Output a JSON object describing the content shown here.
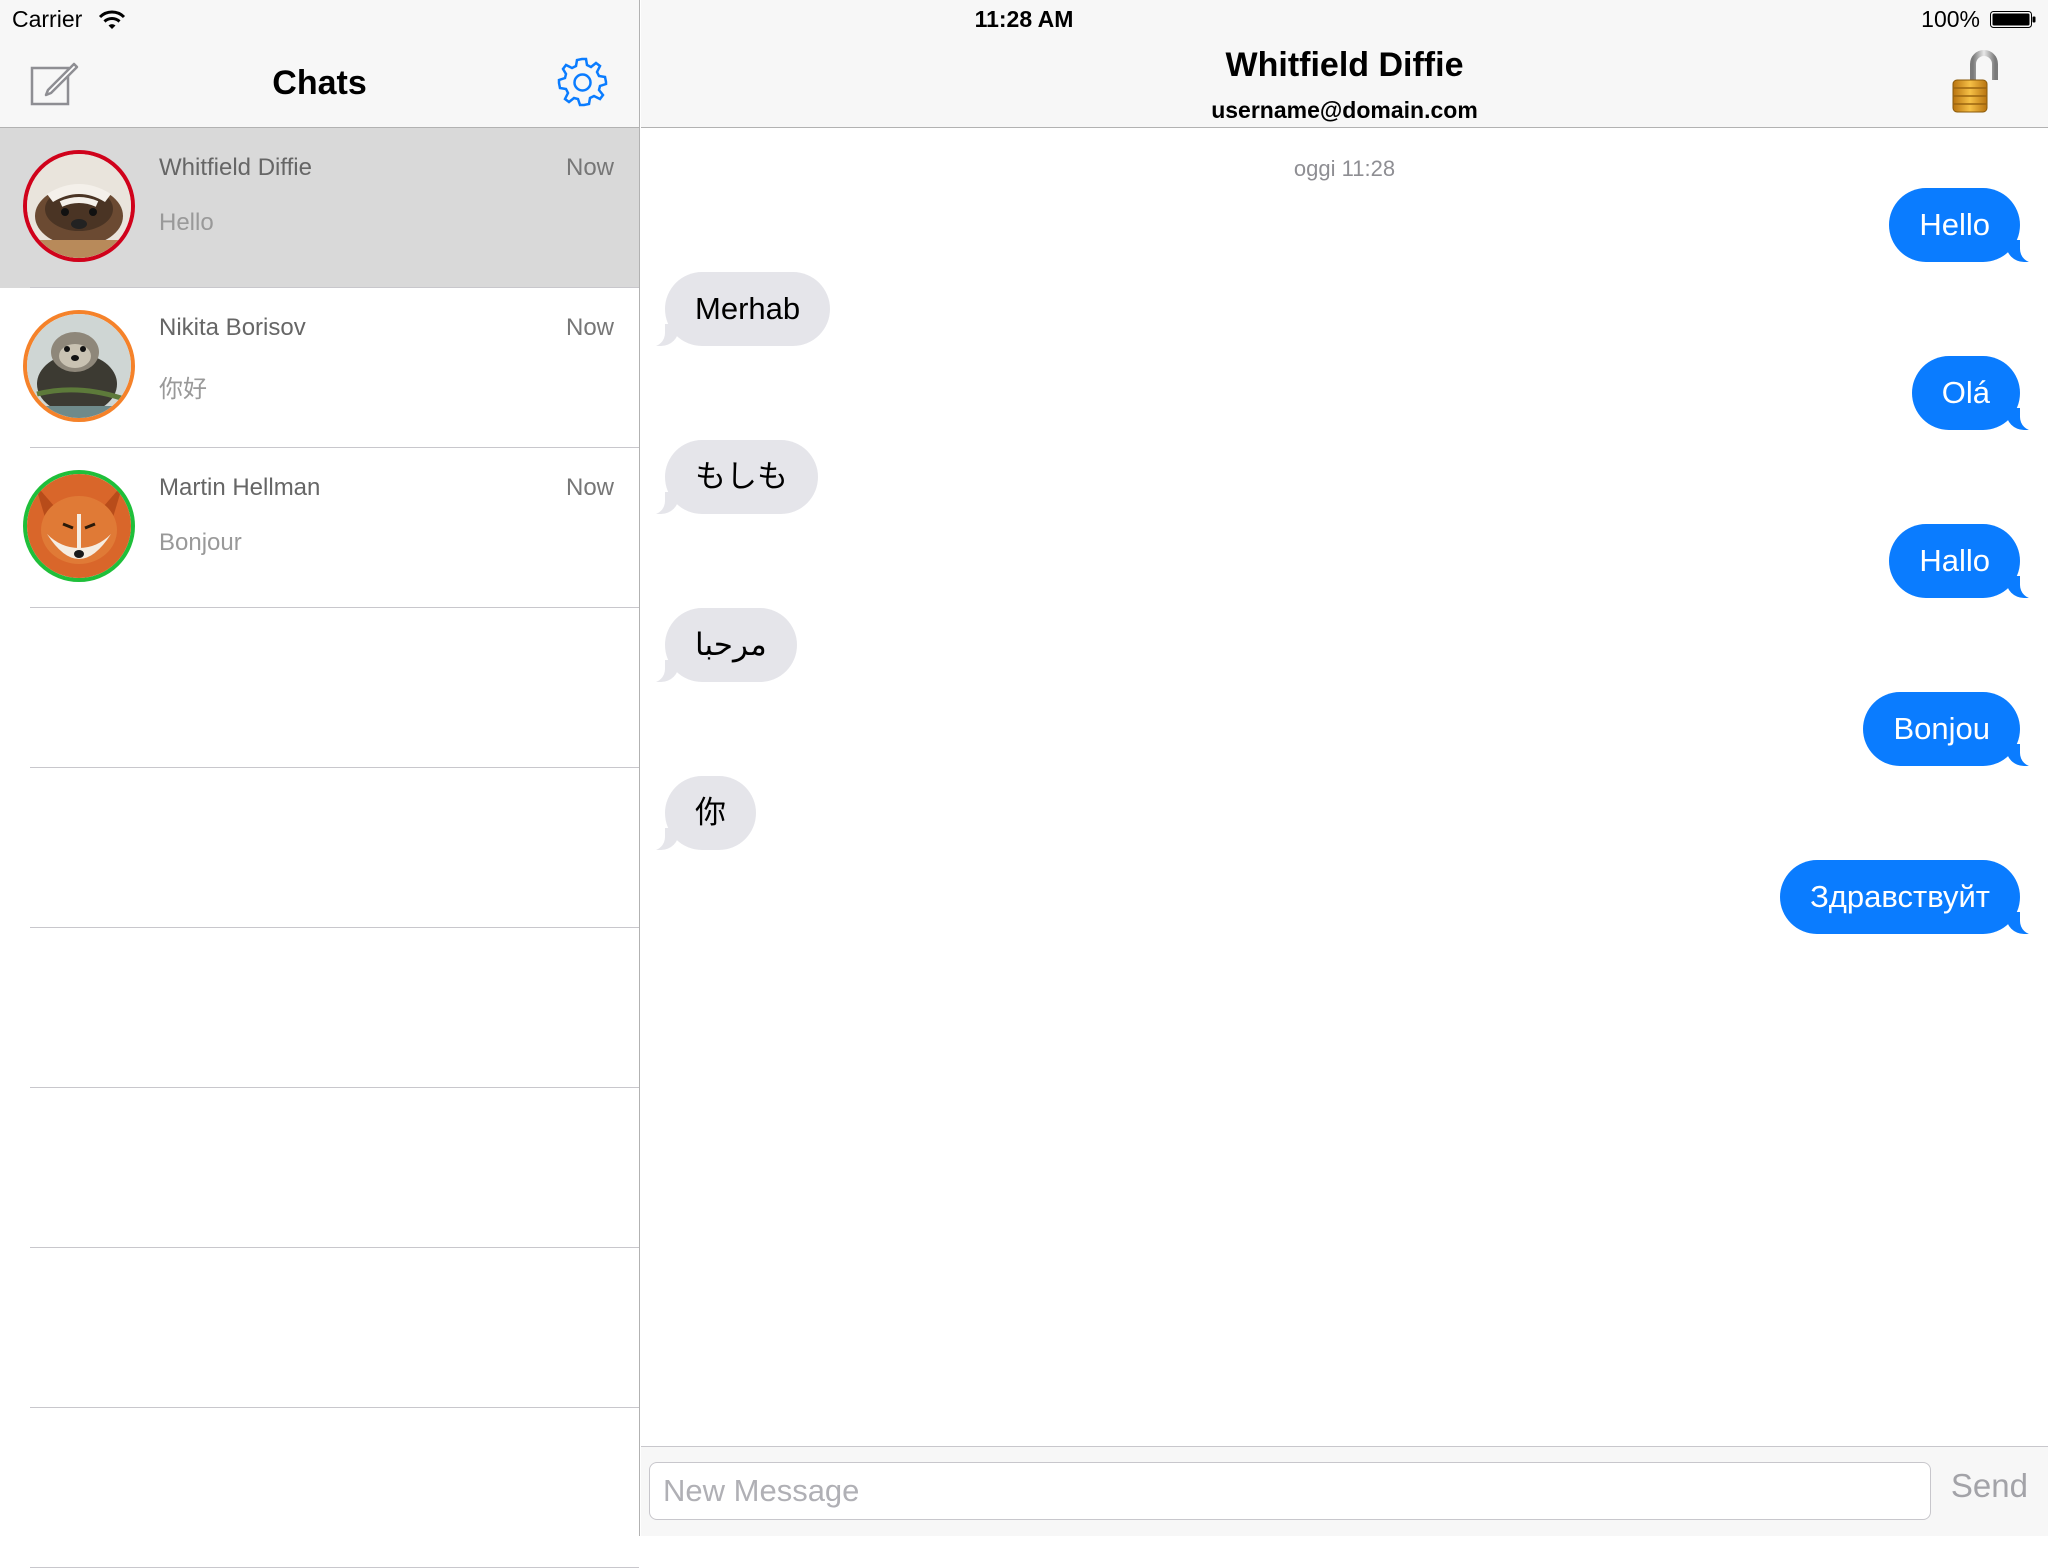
{
  "status_bar": {
    "carrier": "Carrier",
    "time": "11:28 AM",
    "battery": "100%"
  },
  "sidebar": {
    "title": "Chats",
    "chats": [
      {
        "name": "Whitfield Diffie",
        "time": "Now",
        "preview": "Hello",
        "ring_color": "#d0021b",
        "selected": true
      },
      {
        "name": "Nikita Borisov",
        "time": "Now",
        "preview": "你好",
        "ring_color": "#f5822a",
        "selected": false
      },
      {
        "name": "Martin Hellman",
        "time": "Now",
        "preview": "Bonjour",
        "ring_color": "#1fbf3a",
        "selected": false
      }
    ]
  },
  "conversation": {
    "contact_name": "Whitfield Diffie",
    "contact_email": "username@domain.com",
    "timestamp": "oggi 11:28",
    "messages": [
      {
        "text": "Hello",
        "direction": "out"
      },
      {
        "text": "Merhab",
        "direction": "in"
      },
      {
        "text": "Olá",
        "direction": "out"
      },
      {
        "text": "もしも",
        "direction": "in"
      },
      {
        "text": "Hallo",
        "direction": "out"
      },
      {
        "text": "مرحبا",
        "direction": "in"
      },
      {
        "text": "Bonjou",
        "direction": "out"
      },
      {
        "text": "你",
        "direction": "in"
      },
      {
        "text": "Здравствуйт",
        "direction": "out"
      }
    ]
  },
  "composer": {
    "placeholder": "New Message",
    "send_label": "Send"
  },
  "colors": {
    "accent": "#0a7cff",
    "incoming_bubble": "#e5e5ea",
    "selected_row": "#d9d9d9"
  }
}
